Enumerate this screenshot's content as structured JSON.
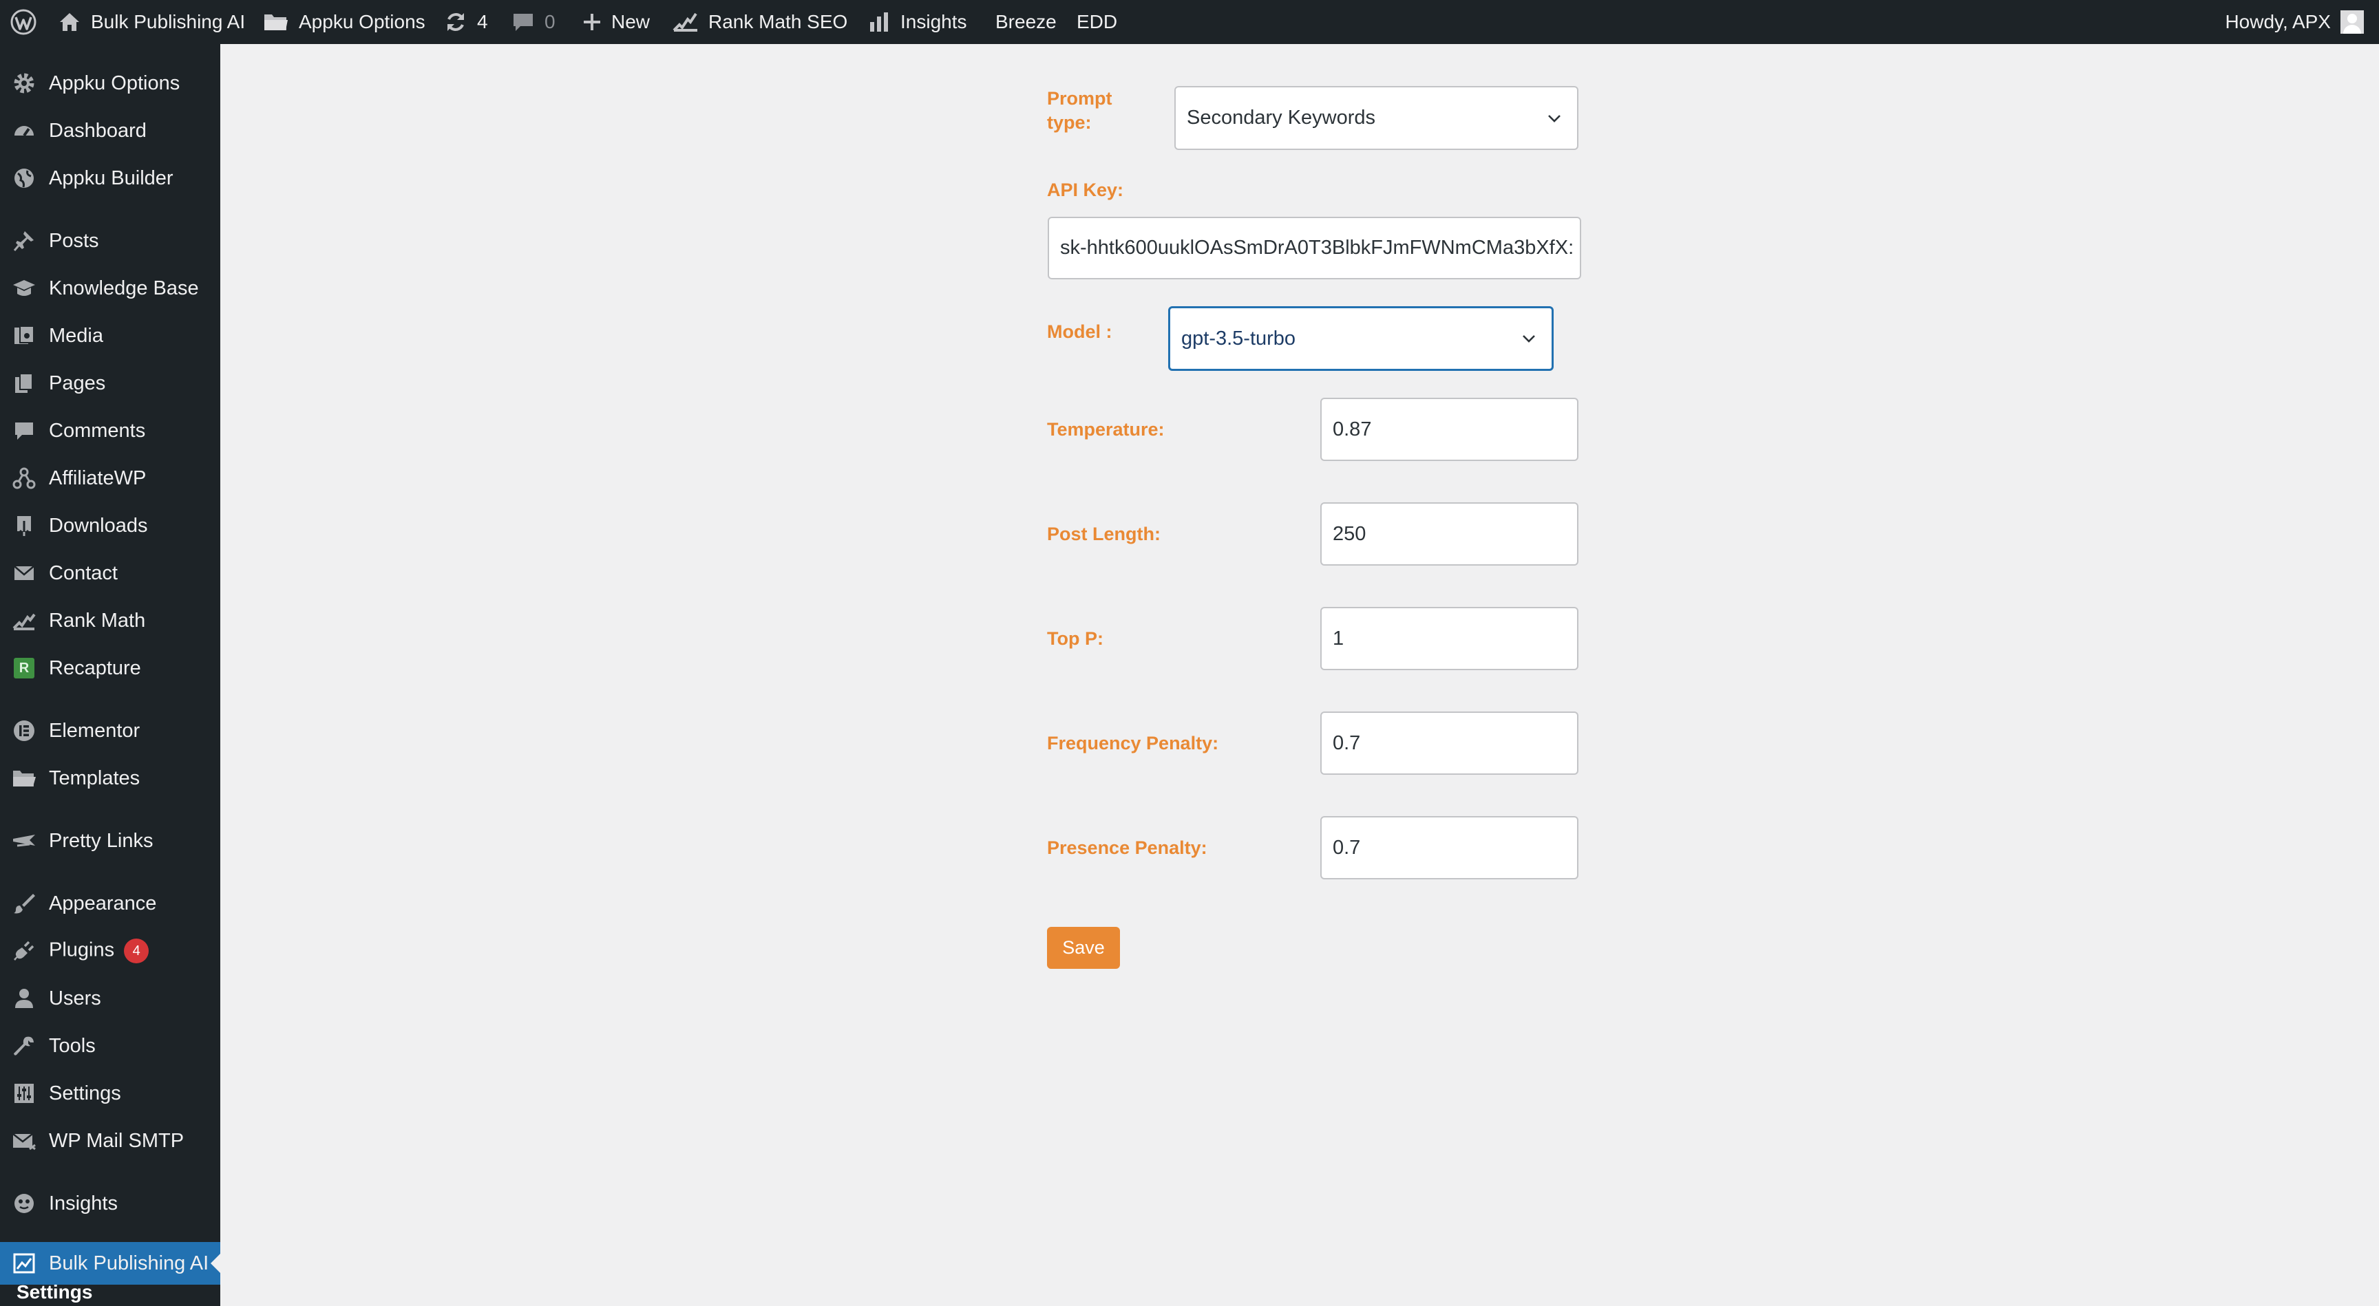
{
  "adminbar": {
    "site_name": "Bulk Publishing AI",
    "appku_options": "Appku Options",
    "updates_count": "4",
    "comments_count": "0",
    "new_label": "New",
    "rank_math_seo": "Rank Math SEO",
    "insights": "Insights",
    "breeze": "Breeze",
    "edd": "EDD",
    "howdy": "Howdy, APX"
  },
  "sidebar": {
    "items": [
      {
        "label": "Appku Options",
        "icon": "gear-icon"
      },
      {
        "label": "Dashboard",
        "icon": "dashboard-icon"
      },
      {
        "label": "Appku Builder",
        "icon": "globe-icon"
      },
      {
        "label": "Posts",
        "icon": "pin-icon"
      },
      {
        "label": "Knowledge Base",
        "icon": "graduation-cap-icon"
      },
      {
        "label": "Media",
        "icon": "media-icon"
      },
      {
        "label": "Pages",
        "icon": "pages-icon"
      },
      {
        "label": "Comments",
        "icon": "comment-icon"
      },
      {
        "label": "AffiliateWP",
        "icon": "share-nodes-icon"
      },
      {
        "label": "Downloads",
        "icon": "download-icon"
      },
      {
        "label": "Contact",
        "icon": "envelope-icon"
      },
      {
        "label": "Rank Math",
        "icon": "chart-icon"
      },
      {
        "label": "Recapture",
        "icon": "recapture-icon"
      },
      {
        "label": "Elementor",
        "icon": "elementor-icon"
      },
      {
        "label": "Templates",
        "icon": "folder-icon"
      },
      {
        "label": "Pretty Links",
        "icon": "links-icon"
      },
      {
        "label": "Appearance",
        "icon": "brush-icon"
      },
      {
        "label": "Plugins",
        "icon": "plug-icon",
        "badge": "4"
      },
      {
        "label": "Users",
        "icon": "user-icon"
      },
      {
        "label": "Tools",
        "icon": "wrench-icon"
      },
      {
        "label": "Settings",
        "icon": "sliders-icon"
      },
      {
        "label": "WP Mail SMTP",
        "icon": "mail-icon"
      },
      {
        "label": "Insights",
        "icon": "insights-icon"
      },
      {
        "label": "Bulk Publishing AI",
        "icon": "bulk-ai-icon",
        "current": true
      }
    ],
    "submenu_current": "Settings",
    "recapture_letter": "R"
  },
  "form": {
    "prompt_type_label": "Prompt type:",
    "prompt_type_value": "Secondary Keywords",
    "api_key_label": "API Key:",
    "api_key_value": "sk-hhtk600uuklOAsSmDrA0T3BlbkFJmFWNmCMa3bXfX:",
    "model_label": "Model :",
    "model_value": "gpt-3.5-turbo",
    "temperature_label": "Temperature:",
    "temperature_value": "0.87",
    "post_length_label": "Post Length:",
    "post_length_value": "250",
    "top_p_label": "Top P:",
    "top_p_value": "1",
    "frequency_penalty_label": "Frequency Penalty:",
    "frequency_penalty_value": "0.7",
    "presence_penalty_label": "Presence Penalty:",
    "presence_penalty_value": "0.7",
    "save_label": "Save"
  },
  "colors": {
    "adminbar_bg": "#1d2327",
    "accent_orange": "#e98934",
    "current_menu_blue": "#2271b1",
    "badge_red": "#d63638"
  }
}
